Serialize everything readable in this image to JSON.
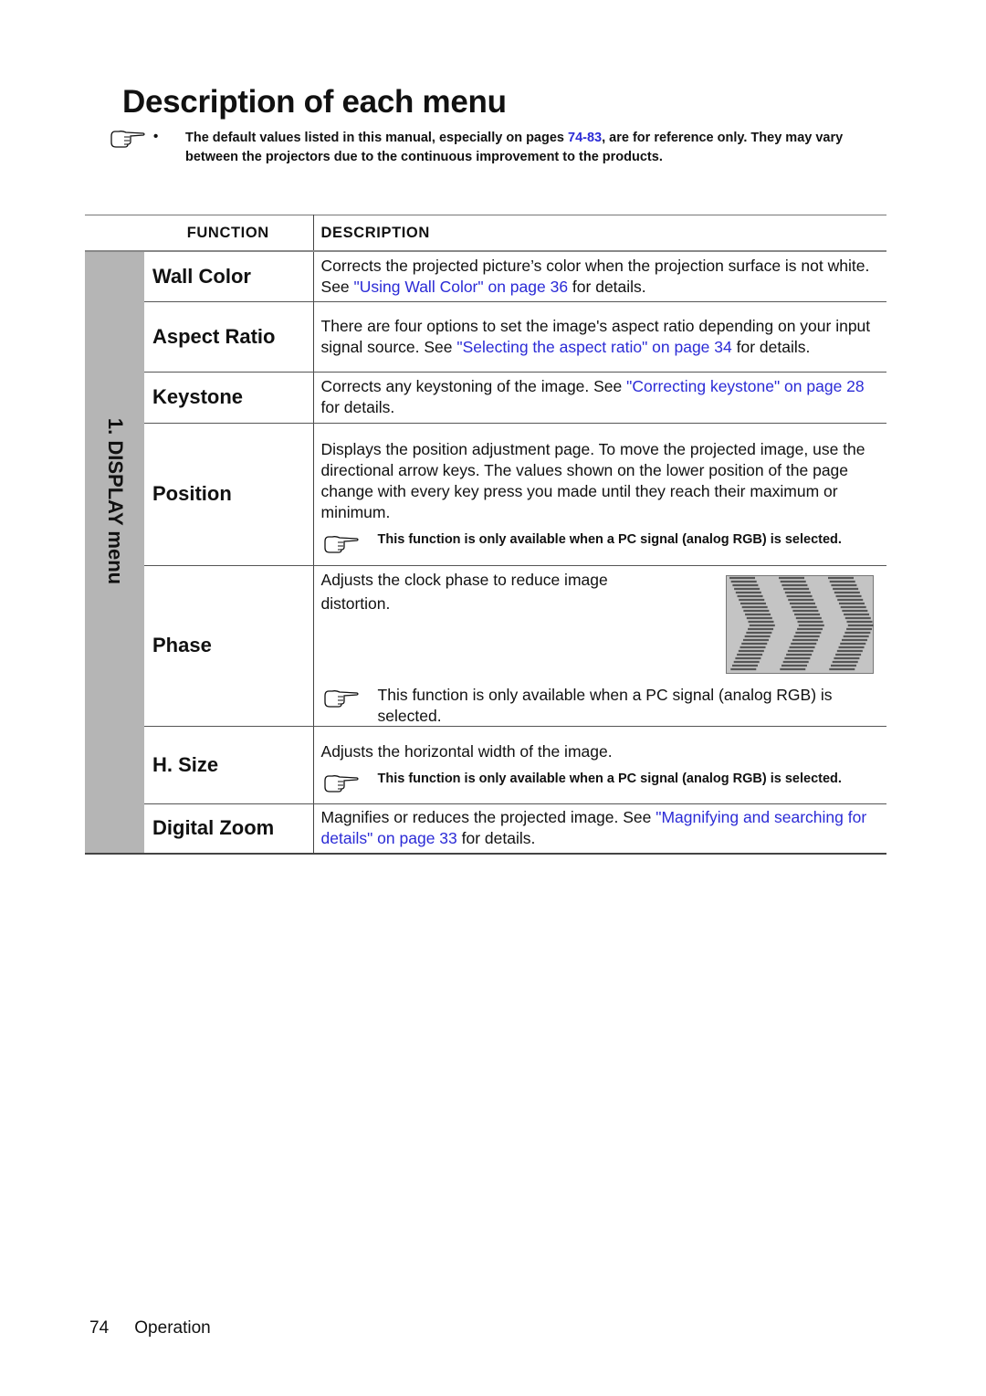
{
  "page": {
    "title": "Description of each menu",
    "top_note": {
      "icon": "pointing-hand-icon",
      "bullet": "•",
      "text_before": "The default values listed in this manual, especially on pages ",
      "link": "74-83",
      "text_after": ", are for reference only. They may vary between the projectors due to the continuous improvement to the products."
    },
    "table": {
      "headers": {
        "function": "FUNCTION",
        "description": "DESCRIPTION"
      },
      "section_label": "1. DISPLAY menu",
      "rows": [
        {
          "function": "Wall Color",
          "desc_before": "Corrects the projected picture’s color when the projection surface is not white. See ",
          "link": "\"Using Wall Color\" on page 36",
          "desc_after": " for details."
        },
        {
          "function": "Aspect Ratio",
          "desc_before": "There are four options to set the image's aspect ratio depending on your input signal source. See ",
          "link": "\"Selecting the aspect ratio\" on page 34",
          "desc_after": " for details."
        },
        {
          "function": "Keystone",
          "desc_before": "Corrects any keystoning of the image. See ",
          "link": "\"Correcting keystone\" on page 28",
          "desc_after": " for details."
        },
        {
          "function": "Position",
          "desc": "Displays the position adjustment page. To move the projected image, use the directional arrow keys. The values shown on the lower position of the page change with every key press you made until they reach their maximum or minimum.",
          "note": "This function is only available when a PC signal (analog RGB) is selected."
        },
        {
          "function": "Phase",
          "desc": "Adjusts the clock phase to reduce image distortion.",
          "image": "phase-distortion-illustration",
          "note": "This function is only available when a PC signal (analog RGB) is selected."
        },
        {
          "function": "H. Size",
          "desc": "Adjusts the horizontal width of the image.",
          "note": "This function is only available when a PC signal (analog RGB) is selected."
        },
        {
          "function": "Digital Zoom",
          "desc_before": "Magnifies or reduces the projected image. See ",
          "link": "\"Magnifying and searching for details\" on page 33",
          "desc_after": " for details."
        }
      ]
    },
    "footer": {
      "page_number": "74",
      "section": "Operation"
    }
  }
}
